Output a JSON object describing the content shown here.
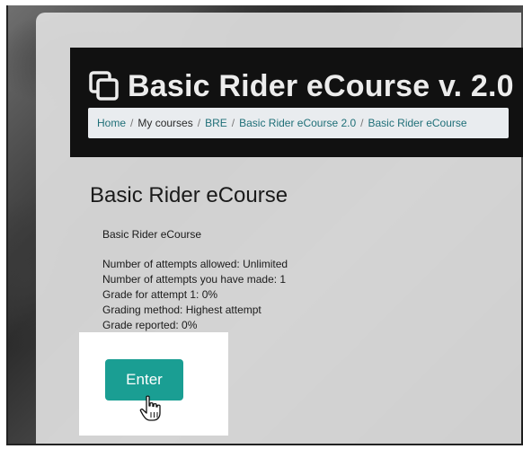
{
  "page": {
    "title": "Basic Rider eCourse v. 2.0",
    "title_icon": "copy-icon"
  },
  "breadcrumb": {
    "items": [
      {
        "label": "Home",
        "link": true
      },
      {
        "label": "My courses",
        "link": false
      },
      {
        "label": "BRE",
        "link": true
      },
      {
        "label": "Basic Rider eCourse 2.0",
        "link": true
      },
      {
        "label": "Basic Rider eCourse",
        "link": true
      }
    ],
    "separator": "/"
  },
  "activity": {
    "heading": "Basic Rider eCourse",
    "summary": "Basic Rider eCourse",
    "attempts_allowed": "Number of attempts allowed: Unlimited",
    "attempts_made": "Number of attempts you have made: 1",
    "grade_attempt": "Grade for attempt 1: 0%",
    "grading_method": "Grading method: Highest attempt",
    "grade_reported": "Grade reported: 0%"
  },
  "actions": {
    "enter_label": "Enter",
    "cursor_icon": "hand-pointer-icon"
  },
  "colors": {
    "accent": "#1a9e93",
    "link": "#1f6f78",
    "header_bg": "#111111"
  }
}
